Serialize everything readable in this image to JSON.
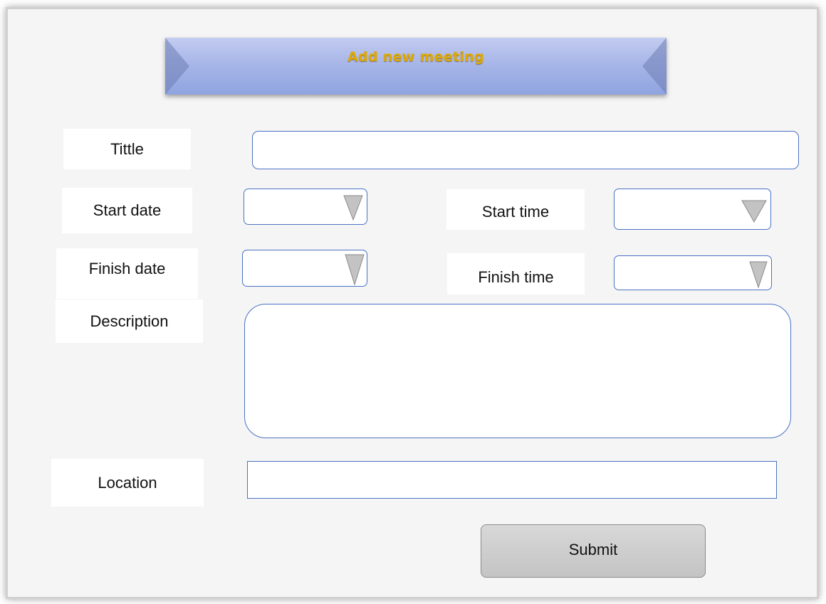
{
  "header": {
    "title": "Add new meeting"
  },
  "form": {
    "title_label": "Tittle",
    "title_value": "",
    "start_date_label": "Start date",
    "start_date_value": "",
    "start_time_label": "Start time",
    "start_time_value": "",
    "finish_date_label": "Finish date",
    "finish_date_value": "",
    "finish_time_label": "Finish time",
    "finish_time_value": "",
    "description_label": "Description",
    "description_value": "",
    "location_label": "Location",
    "location_value": "",
    "submit_label": "Submit"
  },
  "icons": {
    "dropdown": "chevron-down-icon"
  },
  "colors": {
    "field_border": "#4a72c4",
    "banner_gradient_top": "#c3ccf0",
    "banner_gradient_bottom": "#8fa4e0",
    "title_text": "#e0a800",
    "submit_background": "#c8c8c8",
    "panel_background": "#f5f5f5"
  }
}
